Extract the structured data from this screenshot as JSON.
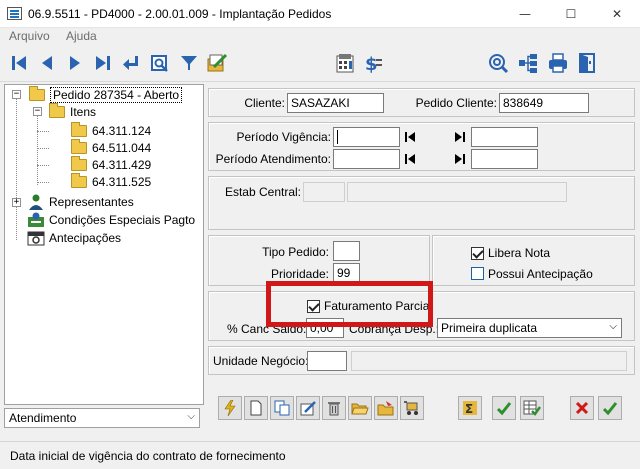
{
  "window": {
    "title": "06.9.5511 - PD4000 - 2.00.01.009 - Implantação Pedidos",
    "minimize_glyph": "—",
    "maximize_glyph": "☐",
    "close_glyph": "✕"
  },
  "menu": [
    "Arquivo",
    "Ajuda"
  ],
  "toolbar": {
    "left_icons": [
      "first-record-icon",
      "previous-record-icon",
      "next-record-icon",
      "last-record-icon",
      "return-icon",
      "preview-icon",
      "filter-icon",
      "edit-document-icon"
    ],
    "middle_icons": [
      "calculator-icon",
      "dollar-icon"
    ],
    "right_icons": [
      "search-globe-icon",
      "tree-structure-icon",
      "print-icon",
      "exit-door-icon"
    ]
  },
  "tree": {
    "root": "Pedido 287354 - Aberto",
    "itens_label": "Itens",
    "items": [
      "64.311.124",
      "64.511.044",
      "64.311.429",
      "64.311.525"
    ],
    "representantes": "Representantes",
    "condicoes": "Condições Especiais Pagto",
    "antecipacoes": "Antecipações"
  },
  "tree_footer_select": "Atendimento",
  "header": {
    "cliente_label": "Cliente:",
    "cliente_value": "SASAZAKI",
    "pedido_cliente_label": "Pedido Cliente:",
    "pedido_cliente_value": "838649"
  },
  "periods": {
    "vigencia_label": "Período Vigência:",
    "atendimento_label": "Período Atendimento:"
  },
  "estab": {
    "label": "Estab Central:"
  },
  "tipo": {
    "tipo_label": "Tipo Pedido:",
    "tipo_value": "",
    "prioridade_label": "Prioridade:",
    "prioridade_value": "99",
    "libera_nota_label": "Libera Nota",
    "libera_nota_checked": true,
    "possui_antecipacao_label": "Possui Antecipação",
    "possui_antecipacao_checked": false
  },
  "faturamento": {
    "parcial_label": "Faturamento Parcial",
    "parcial_checked": true,
    "canc_saldo_label": "% Canc Saldo:",
    "canc_saldo_value": "0,00",
    "cobranca_label": "Cobrança Desp.:",
    "cobranca_value": "Primeira duplicata"
  },
  "unidade": {
    "label": "Unidade Negócio:",
    "value": ""
  },
  "bottom_icons": [
    "lightning-icon",
    "new-document-icon",
    "copy-documents-icon",
    "edit-pencil-icon",
    "trash-icon",
    "open-folder-icon",
    "folder-arrow-icon",
    "cart-icon",
    "sum-icon",
    "checkmark-green-icon",
    "grid-check-icon",
    "cancel-icon",
    "confirm-icon"
  ],
  "status_bar": "Data inicial de vigência do contrato de fornecimento",
  "colors": {
    "highlight": "#d01818",
    "toolbar_blue": "#1e73be"
  }
}
